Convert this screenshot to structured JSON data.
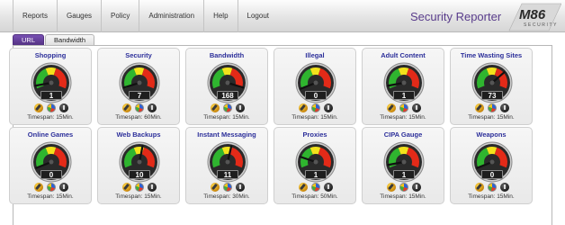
{
  "nav": {
    "items": [
      "Reports",
      "Gauges",
      "Policy",
      "Administration",
      "Help",
      "Logout"
    ]
  },
  "app_title": "Security Reporter",
  "logo_text": "M86 SECURITY",
  "tabs": [
    "URL",
    "Bandwidth"
  ],
  "active_tab": "URL",
  "gauge_colors": {
    "low": "#2fb52f",
    "mid": "#f2e21c",
    "high": "#e32a18"
  },
  "gauges": [
    {
      "title": "Shopping",
      "value": "1",
      "level": 0.05,
      "timespan": "Timespan: 15Min."
    },
    {
      "title": "Security",
      "value": "7",
      "level": 0.02,
      "timespan": "Timespan: 60Min."
    },
    {
      "title": "Bandwidth",
      "value": "168",
      "level": 0.98,
      "timespan": "Timespan: 15Min."
    },
    {
      "title": "Illegal",
      "value": "0",
      "level": 0.0,
      "timespan": "Timespan: 15Min."
    },
    {
      "title": "Adult Content",
      "value": "1",
      "level": 0.05,
      "timespan": "Timespan: 15Min."
    },
    {
      "title": "Time Wasting Sites",
      "value": "73",
      "level": 0.72,
      "timespan": "Timespan: 15Min."
    },
    {
      "title": "Online Games",
      "value": "0",
      "level": 0.0,
      "timespan": "Timespan: 15Min."
    },
    {
      "title": "Web Backups",
      "value": "10",
      "level": 0.55,
      "timespan": "Timespan: 15Min."
    },
    {
      "title": "Instant Messaging",
      "value": "11",
      "level": 0.56,
      "timespan": "Timespan: 30Min."
    },
    {
      "title": "Proxies",
      "value": "1",
      "level": 0.18,
      "timespan": "Timespan: 50Min."
    },
    {
      "title": "CIPA Gauge",
      "value": "1",
      "level": 0.05,
      "timespan": "Timespan: 15Min."
    },
    {
      "title": "Weapons",
      "value": "0",
      "level": 0.0,
      "timespan": "Timespan: 15Min."
    }
  ],
  "gauge_icons": [
    "edit-icon",
    "pie-chart-icon",
    "power-icon"
  ]
}
